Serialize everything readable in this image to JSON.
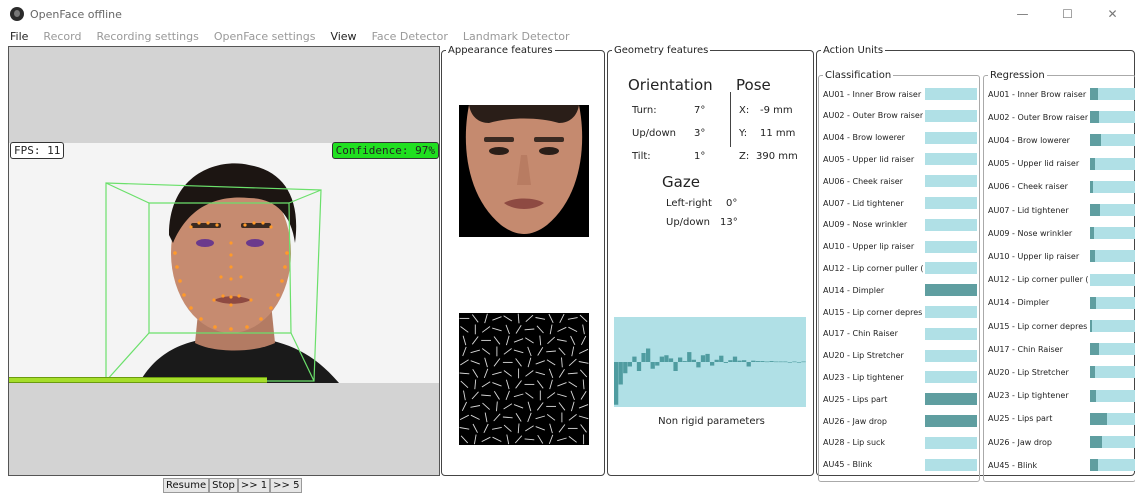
{
  "window": {
    "title": "OpenFace offline",
    "minimize": "—",
    "maximize": "☐",
    "close": "✕"
  },
  "menu": [
    "File",
    "Record",
    "Recording settings",
    "OpenFace settings",
    "View",
    "Face Detector",
    "Landmark Detector"
  ],
  "video": {
    "fps": "FPS: 11",
    "confidence": "Confidence: 97%",
    "progress_pct": 60
  },
  "controls": [
    "Resume",
    "Stop",
    ">> 1",
    ">> 5"
  ],
  "appearance": {
    "legend": "Appearance features"
  },
  "geometry": {
    "legend": "Geometry features",
    "orientation_title": "Orientation",
    "pose_title": "Pose",
    "turn_label": "Turn:",
    "turn_val": "7°",
    "updown_label": "Up/down",
    "updown_val": "3°",
    "tilt_label": "Tilt:",
    "tilt_val": "1°",
    "x_label": "X:",
    "x_val": "-9 mm",
    "y_label": "Y:",
    "y_val": "11 mm",
    "z_label": "Z:",
    "z_val": "390 mm",
    "gaze_title": "Gaze",
    "gaze_lr_label": "Left-right",
    "gaze_lr_val": "0°",
    "gaze_ud_label": "Up/down",
    "gaze_ud_val": "13°",
    "nonrigid_caption": "Non rigid parameters"
  },
  "chart_data": {
    "type": "bar",
    "values": [
      -0.95,
      -0.5,
      -0.25,
      -0.1,
      0.12,
      -0.2,
      0.2,
      0.3,
      -0.15,
      -0.08,
      0.12,
      0.15,
      0.08,
      -0.2,
      0.1,
      0.02,
      0.22,
      0.05,
      -0.12,
      0.15,
      0.18,
      -0.08,
      0.05,
      0.14,
      -0.02,
      0.04,
      0.12,
      0.03,
      0.04,
      -0.1,
      0.03,
      0.02,
      0.02,
      0.01,
      0.02,
      0.01,
      0.01,
      0.01,
      -0.01,
      0.01,
      -0.01,
      0.01
    ],
    "ylim": [
      -1,
      1
    ],
    "colors": {
      "bar": "#4f9ca0",
      "bg": "#b0e0e6"
    }
  },
  "action_units": {
    "legend": "Action Units",
    "classification_title": "Classification",
    "regression_title": "Regression",
    "colors": {
      "bar": "#b0e0e6",
      "fill": "#5f9ea0"
    },
    "classification": [
      {
        "label": "AU01 - Inner Brow raiser",
        "value": 0
      },
      {
        "label": "AU02 - Outer Brow raiser",
        "value": 0
      },
      {
        "label": "AU04 - Brow lowerer",
        "value": 0
      },
      {
        "label": "AU05 - Upper lid raiser",
        "value": 0
      },
      {
        "label": "AU06 - Cheek raiser",
        "value": 0
      },
      {
        "label": "AU07 - Lid tightener",
        "value": 0
      },
      {
        "label": "AU09 - Nose wrinkler",
        "value": 0
      },
      {
        "label": "AU10 - Upper lip raiser",
        "value": 0
      },
      {
        "label": "AU12 - Lip corner puller (",
        "value": 0
      },
      {
        "label": "AU14 - Dimpler",
        "value": 1
      },
      {
        "label": "AU15 - Lip corner depres",
        "value": 0
      },
      {
        "label": "AU17 - Chin Raiser",
        "value": 0
      },
      {
        "label": "AU20 - Lip Stretcher",
        "value": 0
      },
      {
        "label": "AU23 - Lip tightener",
        "value": 0
      },
      {
        "label": "AU25 - Lips part",
        "value": 1
      },
      {
        "label": "AU26 - Jaw drop",
        "value": 1
      },
      {
        "label": "AU28 - Lip suck",
        "value": 0
      },
      {
        "label": "AU45 - Blink",
        "value": 0
      }
    ],
    "regression": [
      {
        "label": "AU01 - Inner Brow raiser",
        "value": 0.15
      },
      {
        "label": "AU02 - Outer Brow raiser",
        "value": 0.17
      },
      {
        "label": "AU04 - Brow lowerer",
        "value": 0.22
      },
      {
        "label": "AU05 - Upper lid raiser",
        "value": 0.1
      },
      {
        "label": "AU06 - Cheek raiser",
        "value": 0.05
      },
      {
        "label": "AU07 - Lid tightener",
        "value": 0.2
      },
      {
        "label": "AU09 - Nose wrinkler",
        "value": 0.08
      },
      {
        "label": "AU10 - Upper lip raiser",
        "value": 0.1
      },
      {
        "label": "AU12 - Lip corner puller (",
        "value": 0
      },
      {
        "label": "AU14 - Dimpler",
        "value": 0.12
      },
      {
        "label": "AU15 - Lip corner depres",
        "value": 0.03
      },
      {
        "label": "AU17 - Chin Raiser",
        "value": 0.18
      },
      {
        "label": "AU20 - Lip Stretcher",
        "value": 0.1
      },
      {
        "label": "AU23 - Lip tightener",
        "value": 0.12
      },
      {
        "label": "AU25 - Lips part",
        "value": 0.32
      },
      {
        "label": "AU26 - Jaw drop",
        "value": 0.24
      },
      {
        "label": "AU45 - Blink",
        "value": 0.16
      }
    ]
  }
}
